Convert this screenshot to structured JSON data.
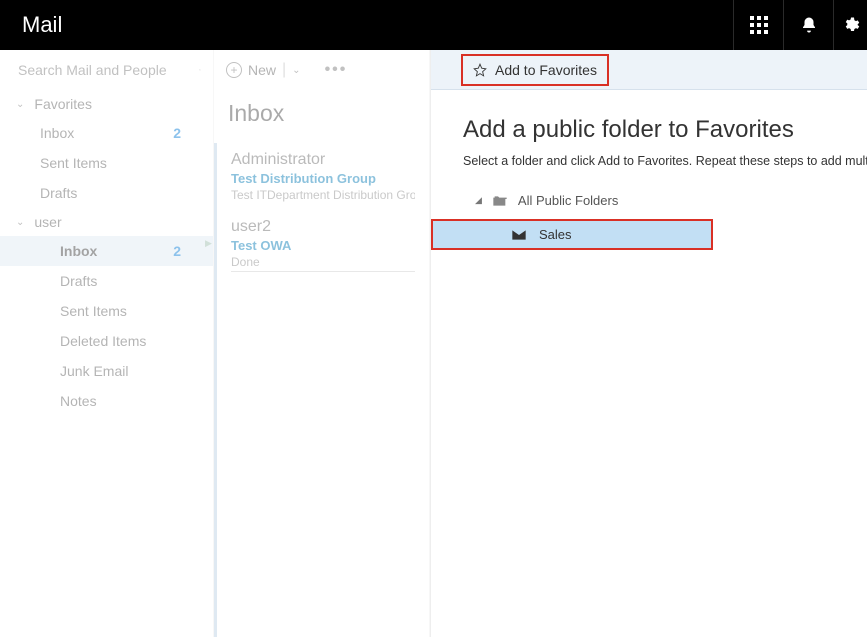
{
  "app": {
    "title": "Mail"
  },
  "search": {
    "placeholder": "Search Mail and People"
  },
  "toolbar": {
    "new_label": "New"
  },
  "sidebar": {
    "sections": [
      {
        "label": "Favorites",
        "items": [
          {
            "label": "Inbox",
            "count": "2"
          },
          {
            "label": "Sent Items",
            "count": ""
          },
          {
            "label": "Drafts",
            "count": ""
          }
        ]
      },
      {
        "label": "user",
        "items": [
          {
            "label": "Inbox",
            "count": "2",
            "selected": true
          },
          {
            "label": "Drafts",
            "count": ""
          },
          {
            "label": "Sent Items",
            "count": ""
          },
          {
            "label": "Deleted Items",
            "count": ""
          },
          {
            "label": "Junk Email",
            "count": ""
          },
          {
            "label": "Notes",
            "count": ""
          }
        ]
      }
    ]
  },
  "messages": {
    "header": "Inbox",
    "items": [
      {
        "from": "Administrator",
        "subject": "Test Distribution Group",
        "preview": "Test ITDepartment Distribution Grou"
      },
      {
        "from": "user2",
        "subject": "Test OWA",
        "done": "Done"
      }
    ]
  },
  "rightpane": {
    "add_favorites_label": "Add to Favorites",
    "title": "Add a public folder to Favorites",
    "subtitle": "Select a folder and click Add to Favorites. Repeat these steps to add multiple",
    "tree_root": "All Public Folders",
    "tree_item": "Sales"
  }
}
